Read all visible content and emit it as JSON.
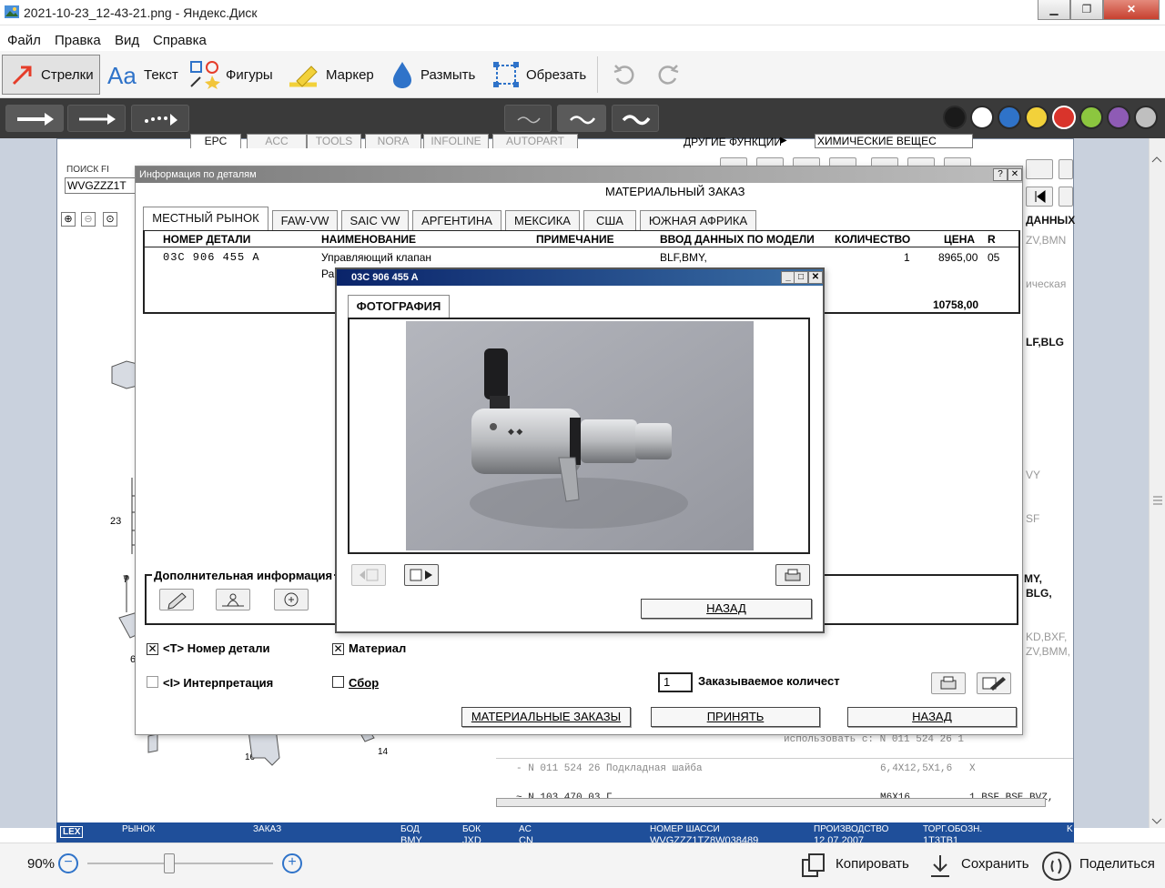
{
  "window": {
    "title": "2021-10-23_12-43-21.png - Яндекс.Диск"
  },
  "menu": [
    "Файл",
    "Правка",
    "Вид",
    "Справка"
  ],
  "toolbar": {
    "arrows": "Стрелки",
    "text": "Текст",
    "shapes": "Фигуры",
    "marker": "Маркер",
    "blur": "Размыть",
    "crop": "Обрезать"
  },
  "palette": [
    "#1a1a1a",
    "#ffffff",
    "#2f73c9",
    "#f2d13a",
    "#d9342b",
    "#8cc63f",
    "#8e5bb5",
    "#bfbfbf"
  ],
  "epc": {
    "top_tabs": [
      "EPC",
      "ACC",
      "TOOLS",
      "NORA",
      "INFOLINE",
      "AUTOPART"
    ],
    "other_functions": "ДРУГИЕ ФУНКЦИИ",
    "chemicals": "ХИМИЧЕСКИЕ ВЕЩЕС",
    "search_label": "ПОИСК FI",
    "search_value": "WVGZZZ1T",
    "data_label": "ДАННЫХ",
    "side_right": [
      "ZV,BMN",
      "ическая",
      "LF,BLG",
      "VY",
      "SF",
      "MY,",
      "BLG,",
      "KD,BXF,",
      "ZV,BMM,"
    ],
    "diagram_labels": [
      "23",
      "7",
      "6",
      "16",
      "14"
    ],
    "list_rows": [
      {
        "text": "использовать с:  N  011 524 26    1"
      },
      {
        "text": "-      N   011 524 26   Подкладная шайба",
        "dim": "6,4X12,5X1,6",
        "x": "X"
      },
      {
        "text": "~      N   103 470 03   Г...",
        "dim": "M6X16",
        "x": "1   BSF,BSE,BVZ,"
      }
    ],
    "status": {
      "market": "РЫНОК",
      "order": "ЗАКАЗ",
      "body": "БОД",
      "body_val": "BMY",
      "box": "БОК",
      "box_val": "JXD",
      "ac": "AC",
      "ac_val": "CN",
      "chassis": "НОМЕР ШАССИ",
      "chassis_val": "WVGZZZ1TZ8W038489",
      "production": "ПРОИЗВОДСТВО",
      "production_val": "12.07.2007",
      "trade": "ТОРГ.ОБОЗН.",
      "trade_val": "1T3TB1",
      "lex": "LEX",
      "k": "K"
    }
  },
  "info_dialog": {
    "title": "Информация по деталям",
    "heading": "МАТЕРИАЛЬНЫЙ ЗАКАЗ",
    "tabs": [
      "МЕСТНЫЙ РЫНОК",
      "FAW-VW",
      "SAIC VW",
      "АРГЕНТИНА",
      "МЕКСИКА",
      "США",
      "ЮЖНАЯ АФРИКА"
    ],
    "columns": [
      "НОМЕР ДЕТАЛИ",
      "НАИМЕНОВАНИЕ",
      "ПРИМЕЧАНИЕ",
      "ВВОД ДАННЫХ ПО МОДЕЛИ",
      "КОЛИЧЕСТВО",
      "ЦЕНА",
      "R"
    ],
    "row": {
      "part": "03C 906 455 A",
      "name": "Управляющий клапан",
      "name2": "Ра",
      "model": "BLF,BMY,",
      "qty": "1",
      "price": "8965,00",
      "r": "05"
    },
    "total": "10758,00",
    "extra_info": "Дополнительная информация",
    "cb_part": "<T> Номер детали",
    "cb_material": "Материал",
    "cb_interp": "<I> Интерпретация",
    "cb_assembly": "Сбор",
    "qty_value": "1",
    "qty_label": "Заказываемое количест",
    "btn_material_orders": "МАТЕРИАЛЬНЫЕ ЗАКАЗЫ",
    "btn_accept": "ПРИНЯТЬ",
    "btn_back": "НАЗАД"
  },
  "photo_dialog": {
    "title": "03C 906 455 A",
    "tab": "ФОТОГРАФИЯ",
    "back": "НАЗАД"
  },
  "footer": {
    "zoom": "90%",
    "copy": "Копировать",
    "save": "Сохранить",
    "share": "Поделиться"
  }
}
